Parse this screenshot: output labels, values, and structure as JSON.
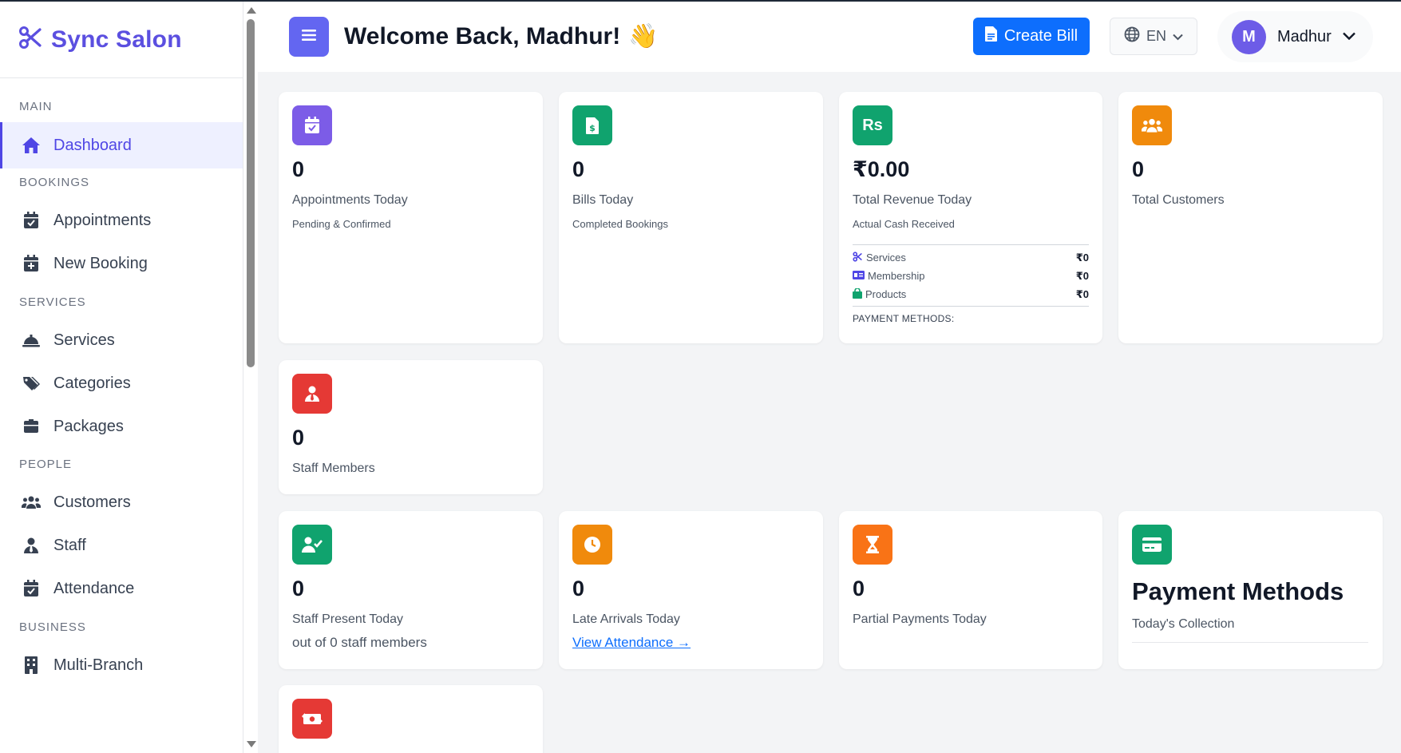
{
  "brand": {
    "name": "Sync Salon"
  },
  "sidebar": {
    "sections": {
      "main": "MAIN",
      "bookings": "BOOKINGS",
      "services": "SERVICES",
      "people": "PEOPLE",
      "business": "BUSINESS"
    },
    "items": {
      "dashboard": "Dashboard",
      "appointments": "Appointments",
      "new_booking": "New Booking",
      "services": "Services",
      "categories": "Categories",
      "packages": "Packages",
      "customers": "Customers",
      "staff": "Staff",
      "attendance": "Attendance",
      "multi_branch": "Multi-Branch"
    }
  },
  "header": {
    "welcome": "Welcome Back, Madhur!",
    "wave_emoji": "👋",
    "create_bill": "Create Bill",
    "language": "EN",
    "user": {
      "initial": "M",
      "name": "Madhur"
    }
  },
  "cards": {
    "appointments": {
      "value": "0",
      "label": "Appointments Today",
      "sub": "Pending & Confirmed",
      "color": "#7c5ce7"
    },
    "bills": {
      "value": "0",
      "label": "Bills Today",
      "sub": "Completed Bookings",
      "color": "#10a36e"
    },
    "revenue": {
      "value": "₹0.00",
      "label": "Total Revenue Today",
      "sub": "Actual Cash Received",
      "icon_text": "Rs",
      "color": "#10a36e",
      "breakdown": {
        "services": {
          "label": "Services",
          "amount": "₹0"
        },
        "membership": {
          "label": "Membership",
          "amount": "₹0"
        },
        "products": {
          "label": "Products",
          "amount": "₹0"
        }
      },
      "payment_methods_label": "PAYMENT METHODS:"
    },
    "customers": {
      "value": "0",
      "label": "Total Customers",
      "color": "#f08a0c"
    },
    "staff": {
      "value": "0",
      "label": "Staff Members",
      "color": "#e53935"
    },
    "staff_present": {
      "value": "0",
      "label": "Staff Present Today",
      "sub": "out of 0 staff members",
      "color": "#10a36e"
    },
    "late_arrivals": {
      "value": "0",
      "label": "Late Arrivals Today",
      "link": "View Attendance →",
      "color": "#f08a0c"
    },
    "partial_payments": {
      "value": "0",
      "label": "Partial Payments Today",
      "color": "#f97316"
    },
    "payment_methods": {
      "title": "Payment Methods",
      "sub": "Today's Collection",
      "color": "#10a36e"
    },
    "refunds": {
      "color": "#e53935"
    }
  }
}
